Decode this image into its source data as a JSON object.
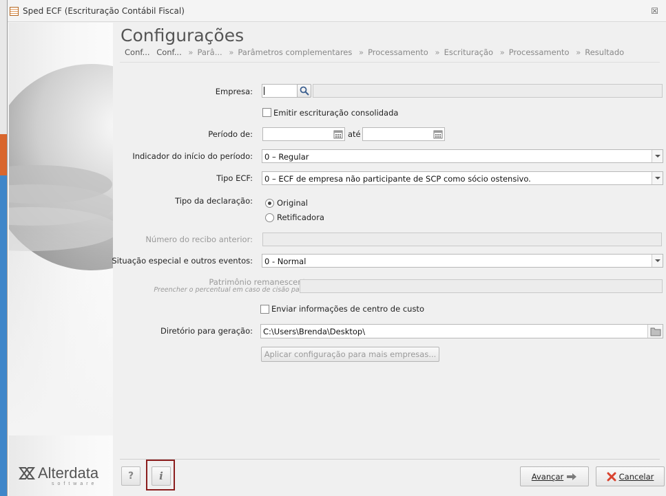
{
  "window": {
    "title": "Sped ECF (Escrituração Contábil Fiscal)",
    "close_glyph": "☒"
  },
  "page": {
    "title": "Configurações",
    "breadcrumb": [
      "Conf...",
      "Conf...",
      "Parâ...",
      "Parâmetros complementares",
      "Processamento",
      "Escrituração",
      "Processamento",
      "Resultado"
    ]
  },
  "form": {
    "empresa": {
      "label": "Empresa:",
      "code": "",
      "name": ""
    },
    "consolidada": {
      "label": "Emitir escrituração consolidada",
      "checked": false
    },
    "periodo": {
      "label": "Período de:",
      "from": "",
      "to_label": "até",
      "to": ""
    },
    "indicador": {
      "label": "Indicador do início do período:",
      "value": "0 – Regular"
    },
    "tipo_ecf": {
      "label": "Tipo ECF:",
      "value": "0 – ECF de empresa não participante de SCP como sócio ostensivo."
    },
    "tipo_declaracao": {
      "label": "Tipo da declaração:",
      "options": [
        "Original",
        "Retificadora"
      ],
      "selected": "Original"
    },
    "recibo": {
      "label": "Número do recibo anterior:",
      "value": ""
    },
    "situacao": {
      "label": "Situação especial e outros eventos:",
      "value": "0 - Normal"
    },
    "patrimonio": {
      "label": "Patrimônio remanescente:",
      "hint": "Preencher o percentual em caso de cisão parcial",
      "value": ""
    },
    "centro_custo": {
      "label": "Enviar informações de centro de custo",
      "checked": false
    },
    "diretorio": {
      "label": "Diretório para geração:",
      "value": "C:\\Users\\Brenda\\Desktop\\"
    },
    "aplicar_label": "Aplicar configuração para mais empresas..."
  },
  "footer": {
    "help_glyph": "?",
    "info_glyph": "i",
    "next_label": "Avançar",
    "cancel_label": "Cancelar"
  },
  "brand": {
    "name": "Alterdata",
    "sub": "software"
  },
  "colors": {
    "highlight": "#8a1c1c",
    "cancel_icon": "#d9432f",
    "next_arrow": "#7a7a7a"
  }
}
